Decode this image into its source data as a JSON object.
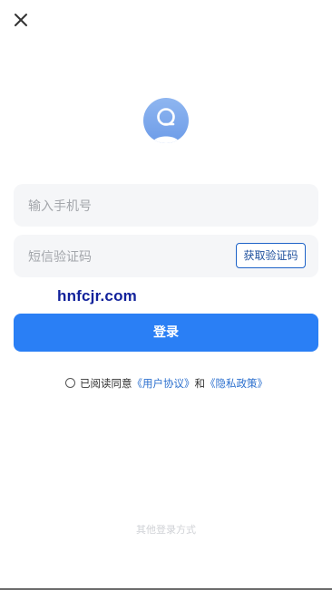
{
  "header": {
    "close_icon": "close-icon"
  },
  "avatar": {
    "icon": "user-avatar-icon",
    "color": "#7ea8ec"
  },
  "phone": {
    "value": "",
    "placeholder": "输入手机号"
  },
  "code": {
    "value": "",
    "placeholder": "短信验证码",
    "get_code_label": "获取验证码"
  },
  "watermark": "hnfcjr.com",
  "login": {
    "label": "登录",
    "color": "#2a7ff5"
  },
  "agreement": {
    "prefix": "已阅读同意",
    "user_agreement": "《用户协议》",
    "and": "和",
    "privacy_policy": "《隐私政策》",
    "checked": false
  },
  "other_login": "其他登录方式"
}
